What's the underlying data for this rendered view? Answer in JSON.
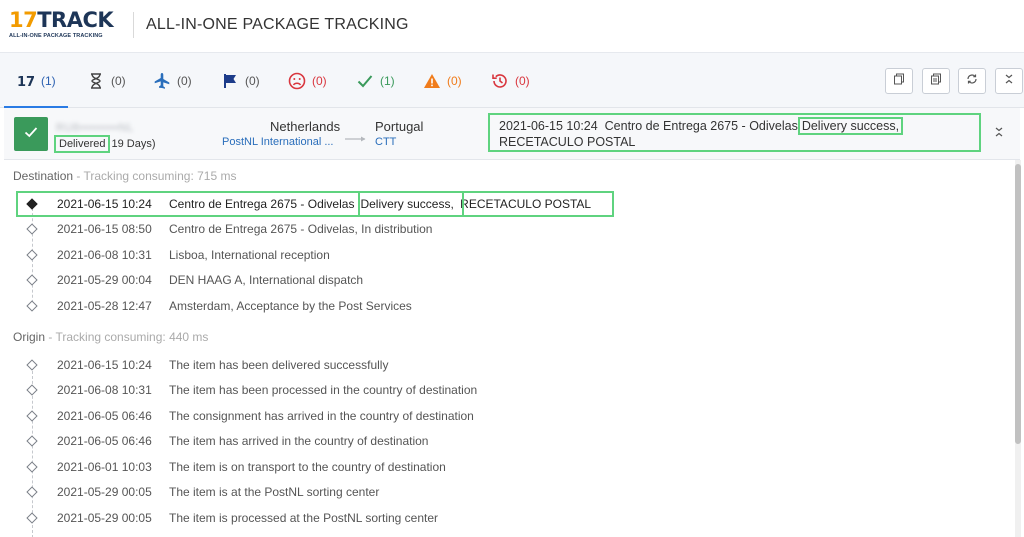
{
  "header": {
    "logo_main_num": "17",
    "logo_main_word": "TRACK",
    "logo_sub": "ALL-IN-ONE PACKAGE TRACKING",
    "title": "ALL-IN-ONE PACKAGE TRACKING"
  },
  "filter_tabs": [
    {
      "icon": "17track-logo-icon",
      "count": "(1)",
      "active": true
    },
    {
      "icon": "hourglass-icon",
      "count": "(0)"
    },
    {
      "icon": "airplane-icon",
      "count": "(0)"
    },
    {
      "icon": "flag-icon",
      "count": "(0)"
    },
    {
      "icon": "sad-face-icon",
      "count": "(0)"
    },
    {
      "icon": "checkmark-icon",
      "count": "(1)"
    },
    {
      "icon": "warning-icon",
      "count": "(0)"
    },
    {
      "icon": "history-icon",
      "count": "(0)"
    }
  ],
  "toolbar": {
    "icons": [
      "copy-icon",
      "copy-all-icon",
      "refresh-icon",
      "expand-collapse-icon"
    ]
  },
  "summary": {
    "tracking_number": "RU8•••••••••NL",
    "status": "Delivered",
    "duration": "19 Days)",
    "origin_country": "Netherlands",
    "origin_carrier": "PostNL International ...",
    "destination_country": "Portugal",
    "destination_carrier": "CTT",
    "latest_event_time": "2021-06-15 10:24",
    "latest_event_place": "Centro de Entrega 2675 - Odivelas",
    "latest_event_status": "Delivery success,",
    "latest_event_detail": "RECETACULO POSTAL"
  },
  "destination": {
    "label": "Destination",
    "consuming": "- Tracking consuming: 715 ms",
    "events": [
      {
        "time": "2021-06-15 10:24",
        "place": "Centro de Entrega 2675 - Odivelas",
        "status": "Delivery success,",
        "detail": "RECETACULO POSTAL"
      },
      {
        "time": "2021-06-15 08:50",
        "desc": "Centro de Entrega 2675 - Odivelas, In distribution"
      },
      {
        "time": "2021-06-08 10:31",
        "desc": "Lisboa, International reception"
      },
      {
        "time": "2021-05-29 00:04",
        "desc": "DEN HAAG A, International dispatch"
      },
      {
        "time": "2021-05-28 12:47",
        "desc": "Amsterdam, Acceptance by the Post Services"
      }
    ]
  },
  "origin": {
    "label": "Origin",
    "consuming": "- Tracking consuming: 440 ms",
    "events": [
      {
        "time": "2021-06-15 10:24",
        "desc": "The item has been delivered successfully"
      },
      {
        "time": "2021-06-08 10:31",
        "desc": "The item has been processed in the country of destination"
      },
      {
        "time": "2021-06-05 06:46",
        "desc": "The consignment has arrived in the country of destination"
      },
      {
        "time": "2021-06-05 06:46",
        "desc": "The item has arrived in the country of destination"
      },
      {
        "time": "2021-06-01 10:03",
        "desc": "The item is on transport to the country of destination"
      },
      {
        "time": "2021-05-29 00:05",
        "desc": "The item is at the PostNL sorting center"
      },
      {
        "time": "2021-05-29 00:05",
        "desc": "The item is processed at the PostNL sorting center"
      }
    ]
  },
  "colors": {
    "highlight": "#5fd37f",
    "delivered_green": "#3a9a5b",
    "link_blue": "#2a6ebb",
    "accent_orange": "#f29b00"
  }
}
